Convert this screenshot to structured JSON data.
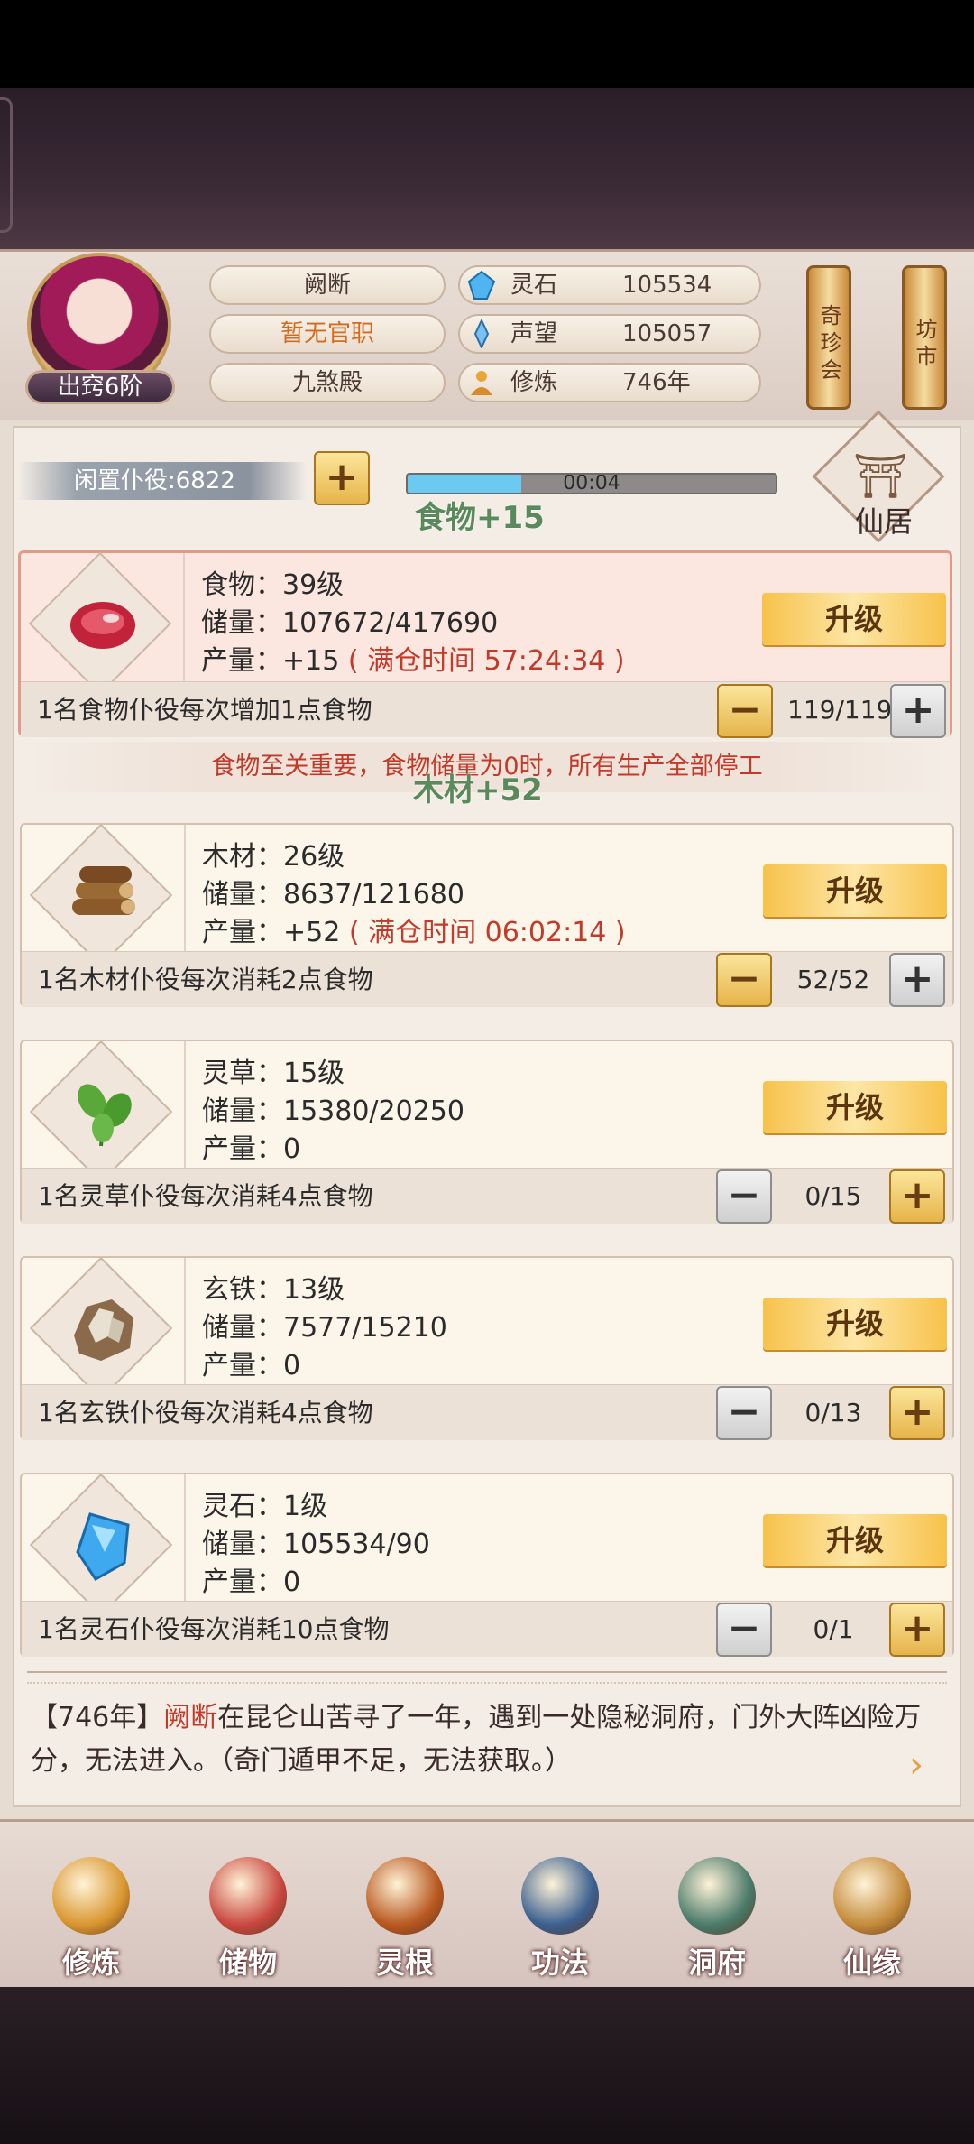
{
  "profile": {
    "rank": "出窍6阶",
    "name": "阙断",
    "office": "暂无官职",
    "hall": "九煞殿"
  },
  "resources": [
    {
      "label": "灵石",
      "value": "105534",
      "icon": "spirit-stone-icon"
    },
    {
      "label": "声望",
      "value": "105057",
      "icon": "prestige-icon"
    },
    {
      "label": "修炼",
      "value": "746年",
      "icon": "cultivation-icon"
    }
  ],
  "side_links": {
    "treasure": "奇珍会",
    "market": "坊市"
  },
  "idle": {
    "label": "闲置仆役:6822",
    "plus": "+",
    "progress_text": "00:04",
    "progress": 0.31,
    "gain_text": "食物+15",
    "wood_gain_text": "木材+52"
  },
  "residence": {
    "label": "仙居",
    "icon": "pagoda-icon"
  },
  "cards": [
    {
      "name": "食物：39级",
      "storage": "储量：107672/417690",
      "output": "产量：+15",
      "full": "( 满仓时间 57:24:34 )",
      "upgrade": "升级",
      "desc": "1名食物仆役每次增加1点食物",
      "count": "119/119",
      "minus": "−",
      "plus": "+",
      "icon": "meat-icon"
    },
    {
      "name": "木材：26级",
      "storage": "储量：8637/121680",
      "output": "产量：+52",
      "full": "( 满仓时间 06:02:14 )",
      "upgrade": "升级",
      "desc": "1名木材仆役每次消耗2点食物",
      "count": "52/52",
      "minus": "−",
      "plus": "+",
      "icon": "wood-icon"
    },
    {
      "name": "灵草：15级",
      "storage": "储量：15380/20250",
      "output": "产量：0",
      "full": "",
      "upgrade": "升级",
      "desc": "1名灵草仆役每次消耗4点食物",
      "count": "0/15",
      "minus": "−",
      "plus": "+",
      "icon": "herb-icon"
    },
    {
      "name": "玄铁：13级",
      "storage": "储量：7577/15210",
      "output": "产量：0",
      "full": "",
      "upgrade": "升级",
      "desc": "1名玄铁仆役每次消耗4点食物",
      "count": "0/13",
      "minus": "−",
      "plus": "+",
      "icon": "iron-ore-icon"
    },
    {
      "name": "灵石：1级",
      "storage": "储量：105534/90",
      "output": "产量：0",
      "full": "",
      "upgrade": "升级",
      "desc": "1名灵石仆役每次消耗10点食物",
      "count": "0/1",
      "minus": "−",
      "plus": "+",
      "icon": "spirit-crystal-icon"
    }
  ],
  "warning": "食物至关重要，食物储量为0时，所有生产全部停工",
  "log": {
    "year": "【746年】",
    "name": "阙断",
    "text": "在昆仑山苦寻了一年，遇到一处隐秘洞府，门外大阵凶险万分，无法进入。（奇门遁甲不足，无法获取。）"
  },
  "nav": [
    {
      "label": "修炼",
      "icon": "cultivate-icon",
      "color": "#d9962f"
    },
    {
      "label": "储物",
      "icon": "bag-icon",
      "color": "#c9473f"
    },
    {
      "label": "灵根",
      "icon": "spirit-root-icon",
      "color": "#b8581f"
    },
    {
      "label": "功法",
      "icon": "book-icon",
      "color": "#3b5f8f"
    },
    {
      "label": "洞府",
      "icon": "cave-mansion-icon",
      "color": "#4a7a6a"
    },
    {
      "label": "仙缘",
      "icon": "gourd-icon",
      "color": "#c48a3a"
    }
  ]
}
